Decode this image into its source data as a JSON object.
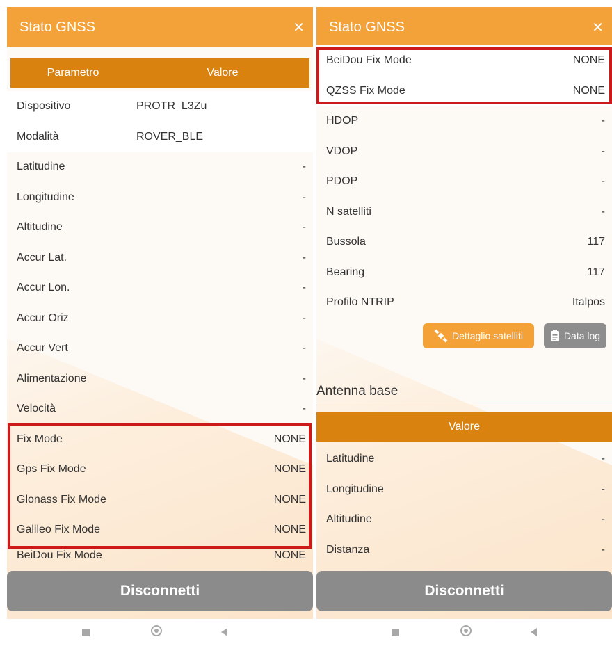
{
  "left": {
    "title": "Stato GNSS",
    "close_glyph": "✕",
    "table_header": {
      "param": "Parametro",
      "value": "Valore"
    },
    "rows": [
      {
        "label": "Dispositivo",
        "value": "PROTR_L3Zu"
      },
      {
        "label": "Modalità",
        "value": "ROVER_BLE"
      },
      {
        "label": "Latitudine",
        "value": "-"
      },
      {
        "label": "Longitudine",
        "value": "-"
      },
      {
        "label": "Altitudine",
        "value": "-"
      },
      {
        "label": "Accur Lat.",
        "value": "-"
      },
      {
        "label": "Accur Lon.",
        "value": "-"
      },
      {
        "label": "Accur Oriz",
        "value": "-"
      },
      {
        "label": "Accur Vert",
        "value": "-"
      },
      {
        "label": "Alimentazione",
        "value": "-"
      },
      {
        "label": "Velocità",
        "value": "-"
      },
      {
        "label": "Fix Mode",
        "value": "NONE"
      },
      {
        "label": "Gps Fix Mode",
        "value": "NONE"
      },
      {
        "label": "Glonass Fix Mode",
        "value": "NONE"
      },
      {
        "label": "Galileo Fix Mode",
        "value": "NONE"
      },
      {
        "label": "BeiDou Fix Mode",
        "value": "NONE"
      }
    ],
    "disconnect_label": "Disconnetti"
  },
  "right": {
    "title": "Stato GNSS",
    "close_glyph": "✕",
    "rows": [
      {
        "label": "BeiDou Fix Mode",
        "value": "NONE"
      },
      {
        "label": "QZSS Fix Mode",
        "value": "NONE"
      },
      {
        "label": "HDOP",
        "value": "-"
      },
      {
        "label": "VDOP",
        "value": "-"
      },
      {
        "label": "PDOP",
        "value": "-"
      },
      {
        "label": "N satelliti",
        "value": "-"
      },
      {
        "label": "Bussola",
        "value": "117"
      },
      {
        "label": "Bearing",
        "value": "117"
      },
      {
        "label": "Profilo NTRIP",
        "value": "Italpos"
      }
    ],
    "buttons": {
      "satellites": "Dettaglio satelliti",
      "datalog": "Data log"
    },
    "antenna_section_title": "Antenna base",
    "antenna_table_header": "Valore",
    "antenna_rows": [
      {
        "label": "Latitudine",
        "value": "-"
      },
      {
        "label": "Longitudine",
        "value": "-"
      },
      {
        "label": "Altitudine",
        "value": "-"
      },
      {
        "label": "Distanza",
        "value": "-"
      }
    ],
    "disconnect_label": "Disconnetti"
  },
  "colors": {
    "titlebar": "#f3a23a",
    "table_header": "#d9820f",
    "highlight_border": "#cc1a1a",
    "disconnect_button": "#8b8b8b"
  },
  "icons": [
    "close-icon",
    "satellite-icon",
    "clipboard-icon",
    "nav-recent-icon",
    "nav-home-icon",
    "nav-back-icon"
  ]
}
